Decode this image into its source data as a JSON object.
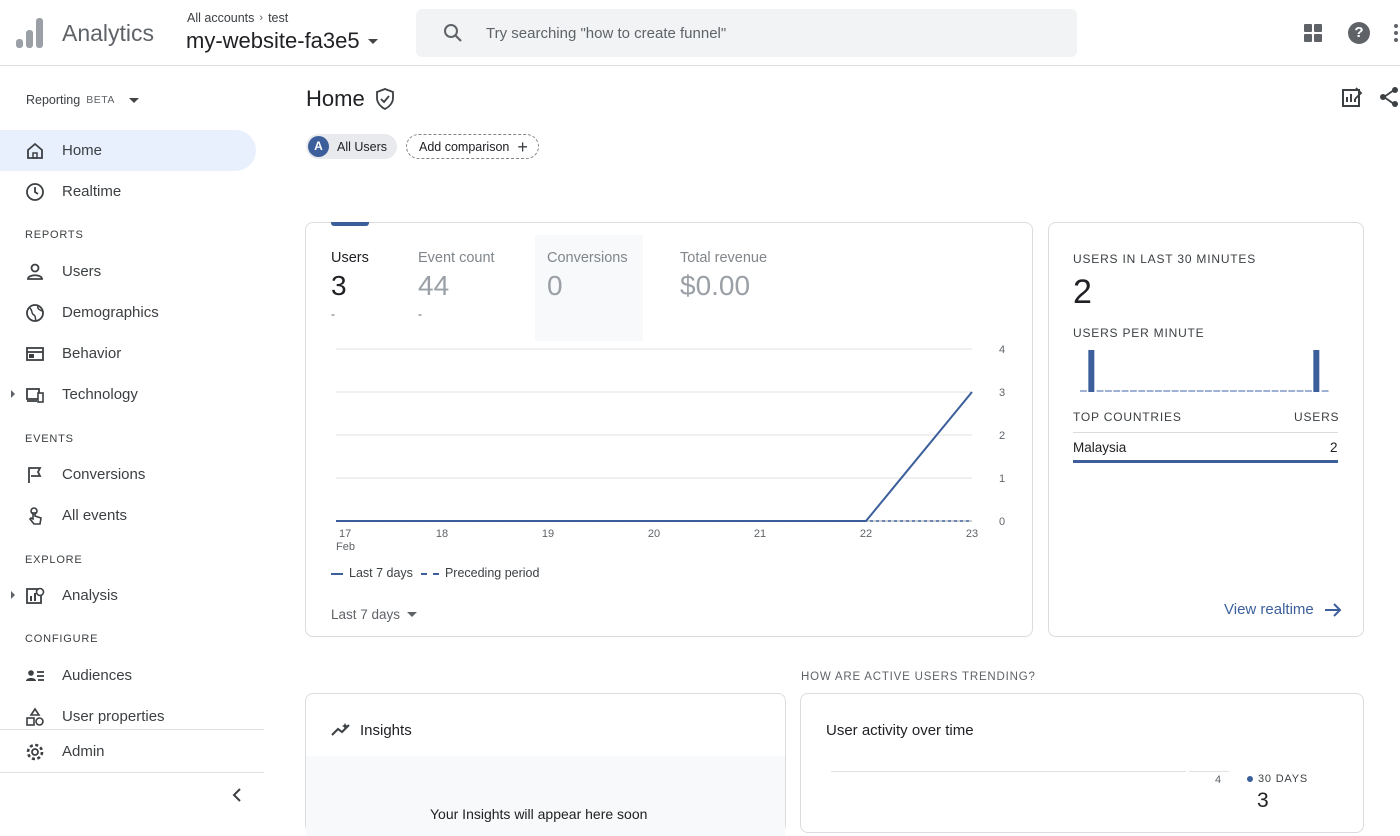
{
  "header": {
    "app_name": "Analytics",
    "breadcrumb": {
      "account": "All accounts",
      "property": "test"
    },
    "property_name": "my-website-fa3e5",
    "search_placeholder": "Try searching \"how to create funnel\""
  },
  "sidebar": {
    "reporting_label": "Reporting",
    "beta_label": "BETA",
    "items": [
      {
        "label": "Home",
        "icon": "home-icon",
        "active": true
      },
      {
        "label": "Realtime",
        "icon": "clock-icon"
      },
      {
        "section": "REPORTS"
      },
      {
        "label": "Users",
        "icon": "person-icon"
      },
      {
        "label": "Demographics",
        "icon": "globe-icon"
      },
      {
        "label": "Behavior",
        "icon": "browser-icon"
      },
      {
        "label": "Technology",
        "icon": "devices-icon",
        "expandable": true
      },
      {
        "section": "EVENTS"
      },
      {
        "label": "Conversions",
        "icon": "flag-icon"
      },
      {
        "label": "All events",
        "icon": "touch-icon"
      },
      {
        "section": "EXPLORE"
      },
      {
        "label": "Analysis",
        "icon": "analysis-icon",
        "expandable": true
      },
      {
        "section": "CONFIGURE"
      },
      {
        "label": "Audiences",
        "icon": "audiences-icon"
      },
      {
        "label": "User properties",
        "icon": "shapes-icon"
      },
      {
        "label": "Admin",
        "icon": "gear-icon"
      }
    ]
  },
  "main": {
    "page_title": "Home",
    "comparison": {
      "avatar": "A",
      "segment": "All Users",
      "add_label": "Add comparison"
    },
    "overview_card": {
      "metrics": [
        {
          "label": "Users",
          "value": "3",
          "delta": "-",
          "selected": true
        },
        {
          "label": "Event count",
          "value": "44",
          "delta": "-"
        },
        {
          "label": "Conversions",
          "value": "0",
          "delta": ""
        },
        {
          "label": "Total revenue",
          "value": "$0.00",
          "delta": ""
        }
      ],
      "legend_current": "Last 7 days",
      "legend_previous": "Preceding period",
      "date_range": "Last 7 days"
    },
    "realtime_card": {
      "users_heading": "USERS IN LAST 30 MINUTES",
      "users_value": "2",
      "per_minute_heading": "USERS PER MINUTE",
      "per_minute": [
        0,
        0,
        0,
        0,
        0,
        0,
        0,
        0,
        0,
        0,
        0,
        0,
        0,
        0,
        0,
        0,
        0,
        0,
        0,
        0,
        0,
        0,
        0,
        0,
        0,
        0,
        0,
        0,
        0,
        0
      ],
      "per_minute_spikes": [
        {
          "minute": 2,
          "value": 1
        },
        {
          "minute": 29,
          "value": 1
        }
      ],
      "top_countries_heading": "TOP COUNTRIES",
      "users_col_heading": "USERS",
      "countries": [
        {
          "name": "Malaysia",
          "users": "2"
        }
      ],
      "view_link": "View realtime"
    },
    "trend_heading": "HOW ARE ACTIVE USERS TRENDING?",
    "insights_card": {
      "title": "Insights",
      "body": "Your Insights will appear here soon"
    },
    "activity_card": {
      "title": "User activity over time",
      "tick": "4",
      "legend": "30 DAYS",
      "value": "3"
    }
  },
  "chart_data": {
    "type": "line",
    "categories": [
      "17 Feb",
      "18",
      "19",
      "20",
      "21",
      "22",
      "23"
    ],
    "series": [
      {
        "name": "Last 7 days",
        "values": [
          0,
          0,
          0,
          0,
          0,
          0,
          3
        ]
      },
      {
        "name": "Preceding period",
        "values": [
          0,
          0,
          0,
          0,
          0,
          0,
          0
        ]
      }
    ],
    "ylim": [
      0,
      4
    ],
    "yticks": [
      "0",
      "1",
      "2",
      "3",
      "4"
    ],
    "grid": true,
    "legend": "bottom-left"
  },
  "colors": {
    "accent": "#3c5f9c",
    "active_nav": "#e8f0fe",
    "link": "#3c5f9c"
  }
}
